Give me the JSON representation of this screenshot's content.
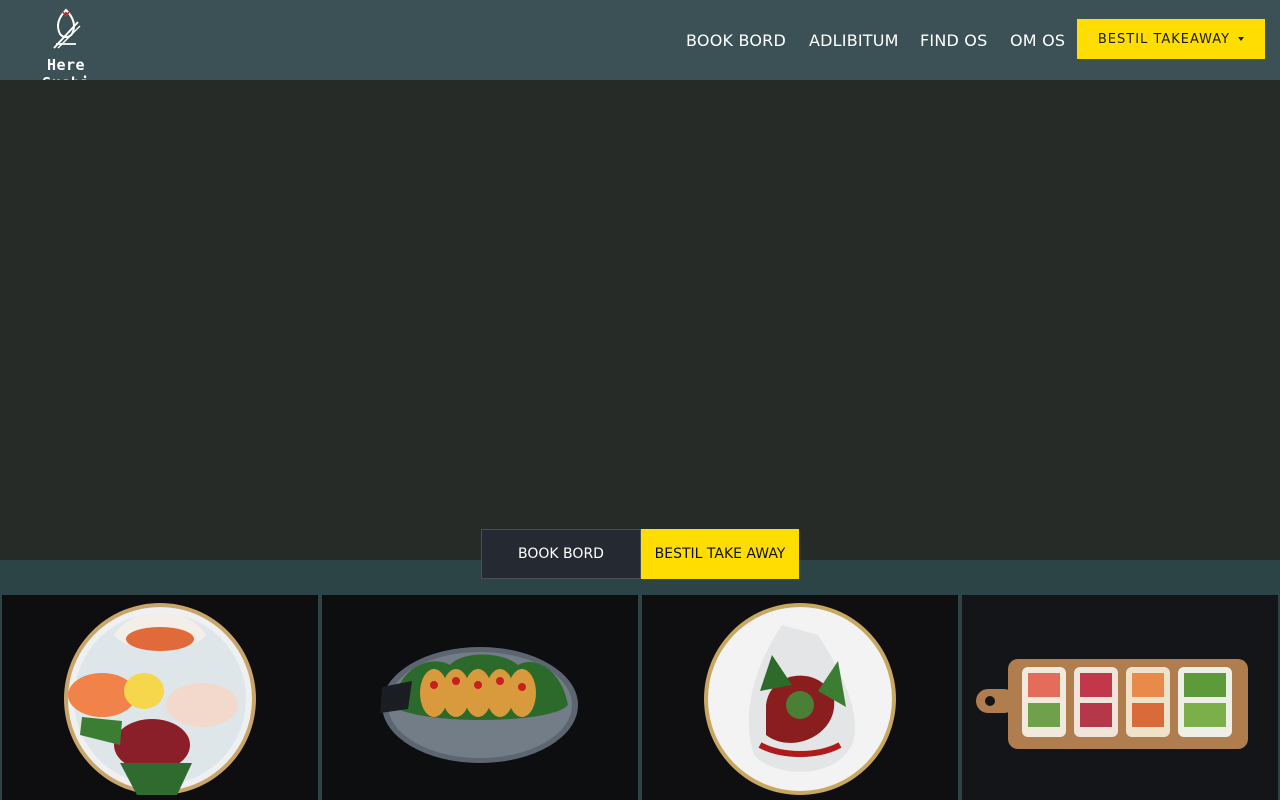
{
  "brand": {
    "name": "Here Sushi",
    "logo_icon": "fish-chopsticks-logo"
  },
  "nav": {
    "items": [
      {
        "label": "BOOK BORD"
      },
      {
        "label": "ADLIBITUM"
      },
      {
        "label": "FIND OS"
      },
      {
        "label": "OM OS"
      }
    ],
    "cta_label": "BESTIL TAKEAWAY"
  },
  "hero": {
    "buttons": {
      "book_label": "BOOK BORD",
      "takeaway_label": "BESTIL TAKE AWAY"
    }
  },
  "gallery": {
    "images": [
      {
        "name": "sashimi-platter-image"
      },
      {
        "name": "gyoza-plate-image"
      },
      {
        "name": "tuna-tataki-bowl-image"
      },
      {
        "name": "sushi-rolls-board-image"
      }
    ]
  },
  "colors": {
    "header_bg": "#3b5156",
    "hero_bg": "#262b27",
    "accent_yellow": "#ffdd00",
    "band_bg": "#2c4446"
  }
}
